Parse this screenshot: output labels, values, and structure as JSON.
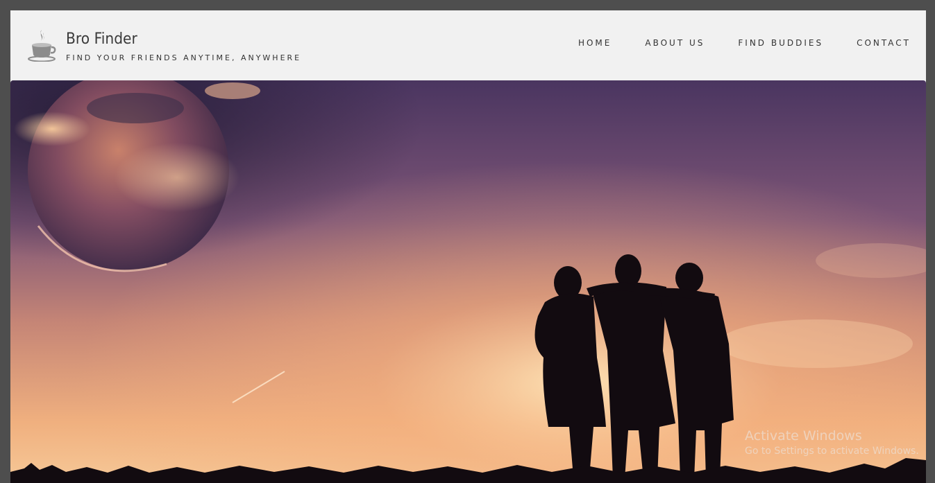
{
  "site": {
    "title": "Bro Finder",
    "tagline": "FIND YOUR FRIENDS ANYTIME, ANYWHERE",
    "logo_icon": "coffee-cup-icon"
  },
  "nav": {
    "items": [
      {
        "label": "HOME"
      },
      {
        "label": "ABOUT US"
      },
      {
        "label": "FIND BUDDIES"
      },
      {
        "label": "CONTACT"
      }
    ]
  },
  "hero": {
    "image": "sunset sky with planet and three friends silhouette"
  },
  "watermark": {
    "title": "Activate Windows",
    "subtitle": "Go to Settings to activate Windows."
  },
  "colors": {
    "page_border": "#4e4e4e",
    "header_bg": "#f1f1f1",
    "text": "#333333"
  }
}
